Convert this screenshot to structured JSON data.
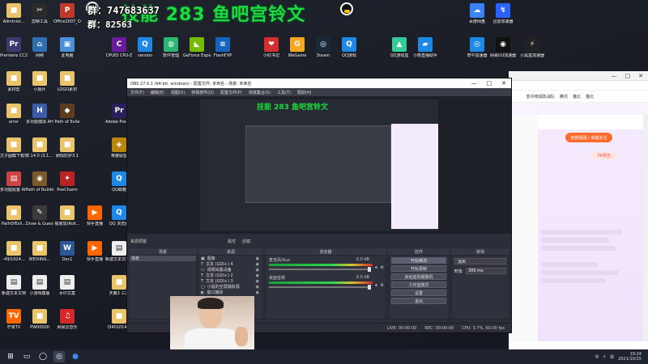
{
  "overlay": {
    "id_line": "群：747683637",
    "id_line2": "群：82563",
    "title_text": "技能 283 鱼吧宫铃文"
  },
  "desktop_icons": [
    {
      "name": "administrator",
      "label": "Administ...",
      "color": "#e9c46a",
      "glyph": "■"
    },
    {
      "name": "jianying",
      "label": "剪映工具",
      "color": "#2b2b2b",
      "glyph": "✂"
    },
    {
      "name": "office2007",
      "label": "Office2007_Office激活",
      "color": "#c0392b",
      "glyph": "P"
    },
    {
      "name": "premiere",
      "label": "Premiere CC2019",
      "color": "#3a3a6e",
      "glyph": "Pr"
    },
    {
      "name": "network",
      "label": "网络",
      "color": "#2d6fb1",
      "glyph": "⌂"
    },
    {
      "name": "recycle-bin",
      "label": "此电脑",
      "color": "#4a90d9",
      "glyph": "▣"
    },
    {
      "name": "materials",
      "label": "素材剪",
      "color": "#e9c46a",
      "glyph": "■"
    },
    {
      "name": "xiaojiu",
      "label": "小姐片",
      "color": "#e9c46a",
      "glyph": "■"
    },
    {
      "name": "logo-materials",
      "label": "LOGO素材",
      "color": "#e9c46a",
      "glyph": "■"
    },
    {
      "name": "error",
      "label": "error",
      "color": "#e9c46a",
      "glyph": "■"
    },
    {
      "name": "multi-window",
      "label": "多功能模拟 AHK",
      "color": "#3c5aa6",
      "glyph": "H"
    },
    {
      "name": "path-of-exile",
      "label": "Path of Exile",
      "color": "#5c3d1e",
      "glyph": "◆"
    },
    {
      "name": "wenzi-jieping",
      "label": "文子图截下载地址",
      "color": "#e9c46a",
      "glyph": "■"
    },
    {
      "name": "version-3140",
      "label": "3.14.0 (3.1...",
      "color": "#e9c46a",
      "glyph": "■"
    },
    {
      "name": "clover",
      "label": "刷戏防护3.1",
      "color": "#e9c46a",
      "glyph": "■"
    },
    {
      "name": "multi-config",
      "label": "多功能配置 AH3.0.1...",
      "color": "#c44",
      "glyph": "▤"
    },
    {
      "name": "path-of-building",
      "label": "Path of Building",
      "color": "#7a5a2a",
      "glyph": "◉"
    },
    {
      "name": "poecharm",
      "label": "PoeCharm",
      "color": "#b22",
      "glyph": "✦"
    },
    {
      "name": "path-of-exile-ch",
      "label": "PathOfExil...",
      "color": "#e9c46a",
      "glyph": "■"
    },
    {
      "name": "draw-guess",
      "label": "Draw & Guess",
      "color": "#3a3a3a",
      "glyph": "✎"
    },
    {
      "name": "dujia",
      "label": "独家加(Roll...",
      "color": "#e9c46a",
      "glyph": "■"
    },
    {
      "name": "wuji-1024",
      "label": "-49/1024...",
      "color": "#e9c46a",
      "glyph": "■"
    },
    {
      "name": "weixing",
      "label": "WEIXING...",
      "color": "#e9c46a",
      "glyph": "■"
    },
    {
      "name": "doc1",
      "label": "Doc1",
      "color": "#2b5797",
      "glyph": "W"
    },
    {
      "name": "new-text",
      "label": "新建文本文档",
      "color": "#eee",
      "glyph": "▤"
    },
    {
      "name": "xiaoyouxi",
      "label": "小游戏模版",
      "color": "#eee",
      "glyph": "▤"
    },
    {
      "name": "water-text",
      "label": "水印文案",
      "color": "#eee",
      "glyph": "▤"
    },
    {
      "name": "mangguo",
      "label": "芒果TV",
      "color": "#f60",
      "glyph": "TV"
    },
    {
      "name": "pw00000",
      "label": "PW00000",
      "color": "#e9c46a",
      "glyph": "■"
    },
    {
      "name": "netease-music",
      "label": "网易云音乐",
      "color": "#d62828",
      "glyph": "♫"
    },
    {
      "name": "cpuid",
      "label": "CPUID CPU-Z",
      "color": "#6a1b9a",
      "glyph": "C"
    },
    {
      "name": "version",
      "label": "version",
      "color": "#1e88e5",
      "glyph": "Q"
    },
    {
      "name": "software",
      "label": "软件管理",
      "color": "#2bb673",
      "glyph": "◍"
    },
    {
      "name": "geforce",
      "label": "GeForce Experience",
      "color": "#76b900",
      "glyph": "◣"
    },
    {
      "name": "flashfxp",
      "label": "FlashFXP",
      "color": "#1565c0",
      "glyph": "≋"
    },
    {
      "name": "xiaohongshu",
      "label": "小红书记",
      "color": "#d32f2f",
      "glyph": "❤"
    },
    {
      "name": "wegame",
      "label": "WeGame",
      "color": "#f5a623",
      "glyph": "G"
    },
    {
      "name": "steam",
      "label": "Steam",
      "color": "#1b2838",
      "glyph": "◎"
    },
    {
      "name": "qq-forum",
      "label": "QQ游戏",
      "color": "#1e88e5",
      "glyph": "Q"
    },
    {
      "name": "qq-gamebox",
      "label": "QQ游戏盒",
      "color": "#3c9",
      "glyph": "▲"
    },
    {
      "name": "xiaoliu-live",
      "label": "小熊直播助手",
      "color": "#1e88e5",
      "glyph": "▰"
    },
    {
      "name": "baidu-netdisk",
      "label": "百度网盘",
      "color": "#3b82f6",
      "glyph": "☁"
    },
    {
      "name": "xunlei",
      "label": "迅雷加速器",
      "color": "#2962ff",
      "glyph": "↯"
    },
    {
      "name": "qihu-speed",
      "label": "奇牛加速器",
      "color": "#1e88e5",
      "glyph": "◎"
    },
    {
      "name": "netease-uu",
      "label": "网易UU加速器",
      "color": "#111",
      "glyph": "◉"
    },
    {
      "name": "xiaohei-speed",
      "label": "小黑盒加速器",
      "color": "#222",
      "glyph": "⚡"
    },
    {
      "name": "adobe-premiere",
      "label": "Adobe Premie...",
      "color": "#2a1f5c",
      "glyph": "Pr"
    },
    {
      "name": "yingxiong-lianmeng",
      "label": "英雄联盟",
      "color": "#b8860b",
      "glyph": "◈"
    },
    {
      "name": "qq-mail",
      "label": "QQ邮箱",
      "color": "#1e88e5",
      "glyph": "Q"
    },
    {
      "name": "qq-music",
      "label": "QQ 浏览器",
      "color": "#1e88e5",
      "glyph": "Q"
    },
    {
      "name": "kuaishou",
      "label": "快手直播",
      "color": "#f60",
      "glyph": "▶"
    },
    {
      "name": "kuaishou-live",
      "label": "快手直播",
      "color": "#f60",
      "glyph": "▶"
    },
    {
      "name": "new-folder",
      "label": "新建文本文档(2)",
      "color": "#eee",
      "glyph": "▤"
    },
    {
      "name": "tianyi",
      "label": "天翼3 三游",
      "color": "#e9c46a",
      "glyph": "■"
    },
    {
      "name": "i3401014",
      "label": "I3401014...",
      "color": "#e9c46a",
      "glyph": "■"
    }
  ],
  "browser": {
    "tab_items": [
      "影中南狐影战队",
      "腾讯",
      "猫北",
      "猫北"
    ],
    "follow_label": "鹤随福福 / 来键关注",
    "pk_label": "PK预告",
    "window_controls": [
      "—",
      "□",
      "✕"
    ]
  },
  "obs": {
    "title": "OBS 27.0.1 (64-bit, windows) - 配置文件: 未命名 - 场景: 未命名",
    "window_controls": [
      "—",
      "□",
      "✕"
    ],
    "menu": [
      "文件(F)",
      "编辑(E)",
      "视图(V)",
      "停靠部件(D)",
      "配置文件(P)",
      "场景集合(S)",
      "工具(T)",
      "帮助(H)"
    ],
    "preview_label": "来源预置",
    "properties_button": "属性",
    "filters_button": "滤镜",
    "docks": {
      "scenes": "场景",
      "sources": "来源",
      "mixer": "混音器",
      "transitions": "转场",
      "controls": "控件"
    },
    "scene_items": [
      "场景"
    ],
    "source_items": [
      {
        "icon": "▣",
        "label": "图像"
      },
      {
        "icon": "T",
        "label": "文本 (GDI+) 4"
      },
      {
        "icon": "▭",
        "label": "视频采集设备"
      },
      {
        "icon": "T",
        "label": "文本 (GDI+) 2"
      },
      {
        "icon": "T",
        "label": "文本 (GDI+) 3"
      },
      {
        "icon": "▢",
        "label": "小鼠的全屏捕获源"
      },
      {
        "icon": "◐",
        "label": "窗口捕获"
      }
    ],
    "mixer_rows": [
      {
        "name": "麦克风/Aux",
        "db": "0.0 dB"
      },
      {
        "name": "桌面音频",
        "db": "0.0 dB"
      }
    ],
    "controls": [
      "开始推流",
      "开始录制",
      "启动虚拟摄像机",
      "工作室模式",
      "设置",
      "退出"
    ],
    "transition_type": "淡出",
    "transition_duration_label": "时长",
    "transition_duration": "300 ms",
    "status": {
      "live": "LIVE: 00:00:00",
      "rec": "REC: 00:00:00",
      "cpu": "CPU: 3.7%, 60.00 fps"
    }
  },
  "taskbar": {
    "start_icon": "⊞",
    "pinned": [
      "▭",
      "◯",
      "◎",
      "●"
    ],
    "tray": [
      "中",
      "∧",
      "拼"
    ],
    "time": "19:24",
    "date": "2021/10/15"
  }
}
